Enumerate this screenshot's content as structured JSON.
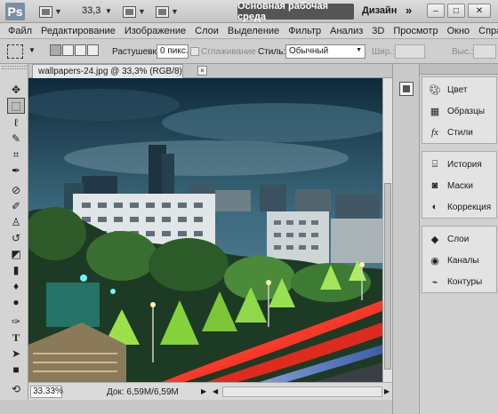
{
  "app": {
    "logo": "Ps",
    "zoom_value": "33,3",
    "workspace_button": "Основная рабочая среда",
    "design_label": "Дизайн",
    "more_chevron": "»"
  },
  "menu": [
    "Файл",
    "Редактирование",
    "Изображение",
    "Слои",
    "Выделение",
    "Фильтр",
    "Анализ",
    "3D",
    "Просмотр",
    "Окно",
    "Справка"
  ],
  "options": {
    "feather_label": "Растушевка:",
    "feather_value": "0 пикс.",
    "antialias_label": "Сглаживание",
    "style_label": "Стиль:",
    "style_value": "Обычный",
    "width_label": "Шир.:",
    "height_label": "Выс.:"
  },
  "document": {
    "tab_title": "wallpapers-24.jpg @ 33,3% (RGB/8)",
    "close_glyph": "×"
  },
  "status": {
    "zoom": "33.33%",
    "doc_info": "Док: 6,59M/6,59M"
  },
  "panels": {
    "group1": [
      {
        "label": "Цвет",
        "icon": "color-palette-icon"
      },
      {
        "label": "Образцы",
        "icon": "swatches-grid-icon"
      },
      {
        "label": "Стили",
        "icon": "styles-fx-icon"
      }
    ],
    "group2": [
      {
        "label": "История",
        "icon": "history-icon"
      },
      {
        "label": "Маски",
        "icon": "masks-icon"
      },
      {
        "label": "Коррекция",
        "icon": "adjustments-icon"
      }
    ],
    "group3": [
      {
        "label": "Слои",
        "icon": "layers-icon"
      },
      {
        "label": "Каналы",
        "icon": "channels-icon"
      },
      {
        "label": "Контуры",
        "icon": "paths-icon"
      }
    ]
  },
  "tools": [
    "move-tool-icon",
    "rect-marquee-tool-icon",
    "lasso-tool-icon",
    "quick-select-tool-icon",
    "crop-tool-icon",
    "eyedropper-tool-icon",
    "healing-brush-tool-icon",
    "brush-tool-icon",
    "clone-stamp-tool-icon",
    "history-brush-tool-icon",
    "eraser-tool-icon",
    "gradient-tool-icon",
    "blur-tool-icon",
    "dodge-tool-icon",
    "pen-tool-icon",
    "type-tool-icon",
    "path-select-tool-icon",
    "shape-tool-icon",
    "3d-rotate-tool-icon",
    "3d-orbit-tool-icon"
  ],
  "colors": {
    "workspace_button_bg": "#555555",
    "panel_bg": "#e3e3e3"
  }
}
